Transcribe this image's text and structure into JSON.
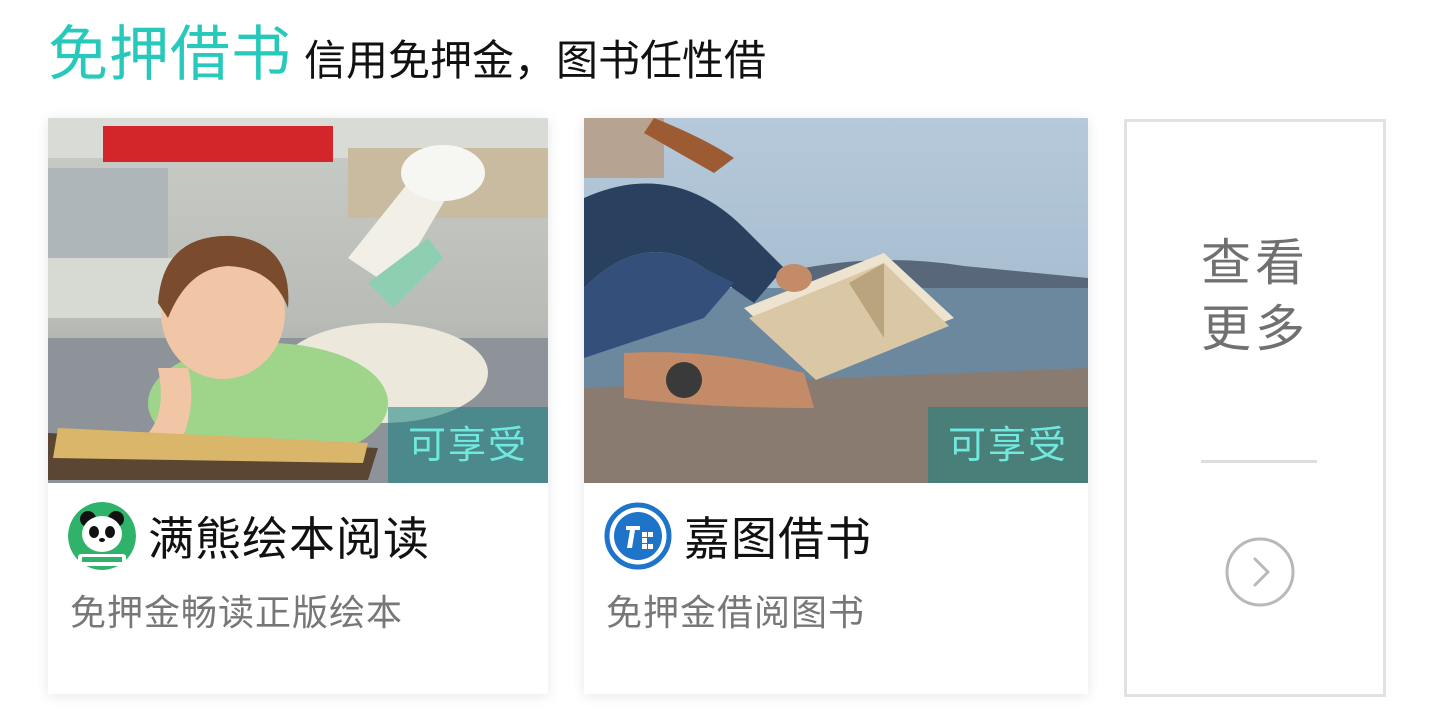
{
  "header": {
    "title": "免押借书",
    "subtitle": "信用免押金，图书任性借"
  },
  "cards": [
    {
      "name": "满熊绘本阅读",
      "description": "免押金畅读正版绘本",
      "badge": "可享受",
      "logo_icon": "panda-logo-icon",
      "image_subject": "girl-reading-icon"
    },
    {
      "name": "嘉图借书",
      "description": "免押金借阅图书",
      "badge": "可享受",
      "logo_icon": "jiatu-logo-icon",
      "image_subject": "woman-reading-seaside-icon"
    }
  ],
  "see_more": {
    "line1": "查看",
    "line2": "更多",
    "arrow_icon": "chevron-right-circle-icon"
  },
  "colors": {
    "accent": "#27c9bb",
    "badge_text": "#6fe8de",
    "text_primary": "#111111",
    "text_secondary": "#777777"
  }
}
